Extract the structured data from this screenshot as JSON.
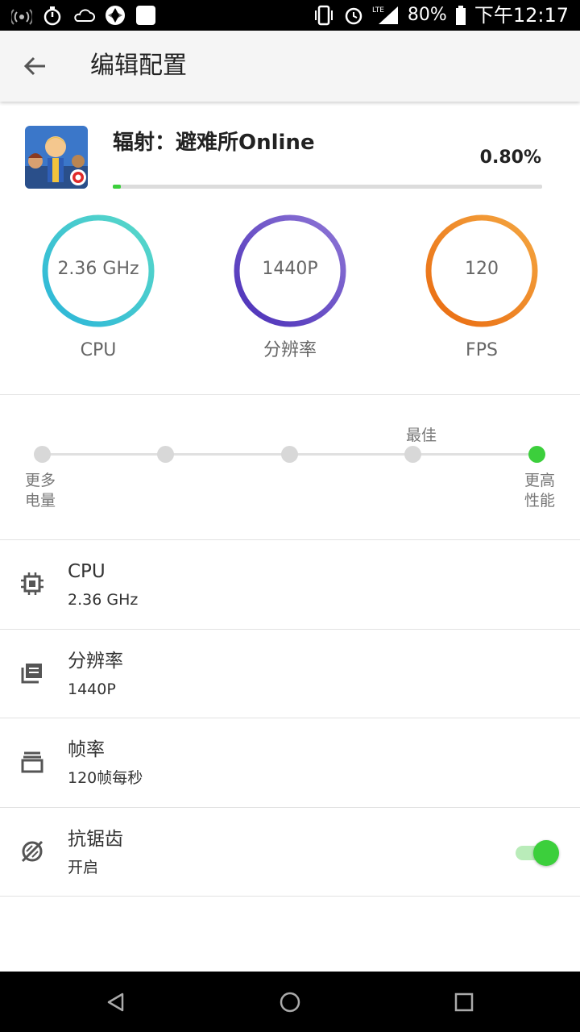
{
  "status_bar": {
    "battery_text": "80%",
    "time": "下午12:17",
    "network": "LTE",
    "icons": [
      "wifi-hotspot-icon",
      "stopwatch-icon",
      "weather-icon",
      "app-icon",
      "notification-icon",
      "vibrate-icon",
      "alarm-icon",
      "signal-icon",
      "battery-icon"
    ]
  },
  "app_bar": {
    "title": "编辑配置",
    "back_icon": "back-arrow-icon"
  },
  "game": {
    "name": "辐射：避难所Online",
    "percent_text": "0.80%",
    "progress_fraction": 0.018,
    "icon": "game-icon"
  },
  "gauges": [
    {
      "value": "2.36 GHz",
      "label": "CPU",
      "colors": [
        "#2bb5d9",
        "#5ad9c8"
      ]
    },
    {
      "value": "1440P",
      "label": "分辨率",
      "colors": [
        "#4a2fb8",
        "#8f77d6"
      ]
    },
    {
      "value": "120",
      "label": "FPS",
      "colors": [
        "#e96a10",
        "#f4a640"
      ]
    }
  ],
  "slider": {
    "best_label": "最佳",
    "left_label_1": "更多",
    "left_label_2": "电量",
    "right_label_1": "更高",
    "right_label_2": "性能",
    "steps": 5,
    "selected_index": 4
  },
  "settings": [
    {
      "title": "CPU",
      "value": "2.36 GHz",
      "icon": "cpu-chip-icon"
    },
    {
      "title": "分辨率",
      "value": "1440P",
      "icon": "resolution-icon"
    },
    {
      "title": "帧率",
      "value": "120帧每秒",
      "icon": "frame-rate-icon"
    },
    {
      "title": "抗锯齿",
      "value": "开启",
      "icon": "anti-aliasing-icon",
      "toggle_on": true
    }
  ],
  "nav_bar": {
    "icons": [
      "nav-back-icon",
      "nav-home-icon",
      "nav-recents-icon"
    ]
  },
  "colors": {
    "accent": "#3ccf3c",
    "divider": "#e2e2e2"
  }
}
